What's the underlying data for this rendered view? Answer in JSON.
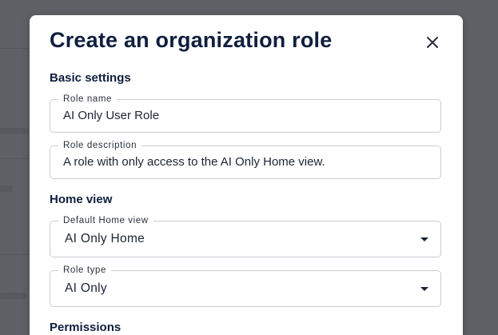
{
  "dialog": {
    "title": "Create an organization role",
    "close_icon": "close-icon"
  },
  "basic_settings": {
    "heading": "Basic settings",
    "role_name": {
      "label": "Role name",
      "value": "AI Only User Role"
    },
    "role_description": {
      "label": "Role description",
      "value": "A role with only access to the AI Only Home view."
    }
  },
  "home_view": {
    "heading": "Home view",
    "default_home_view": {
      "label": "Default Home view",
      "value": "AI Only Home",
      "icon": "chevron-down-icon"
    },
    "role_type": {
      "label": "Role type",
      "value": "AI Only",
      "icon": "chevron-down-icon"
    }
  },
  "permissions": {
    "heading": "Permissions"
  },
  "colors": {
    "overlay": "#5f6167",
    "title": "#0f1f3d",
    "border": "#c9ccd3"
  }
}
